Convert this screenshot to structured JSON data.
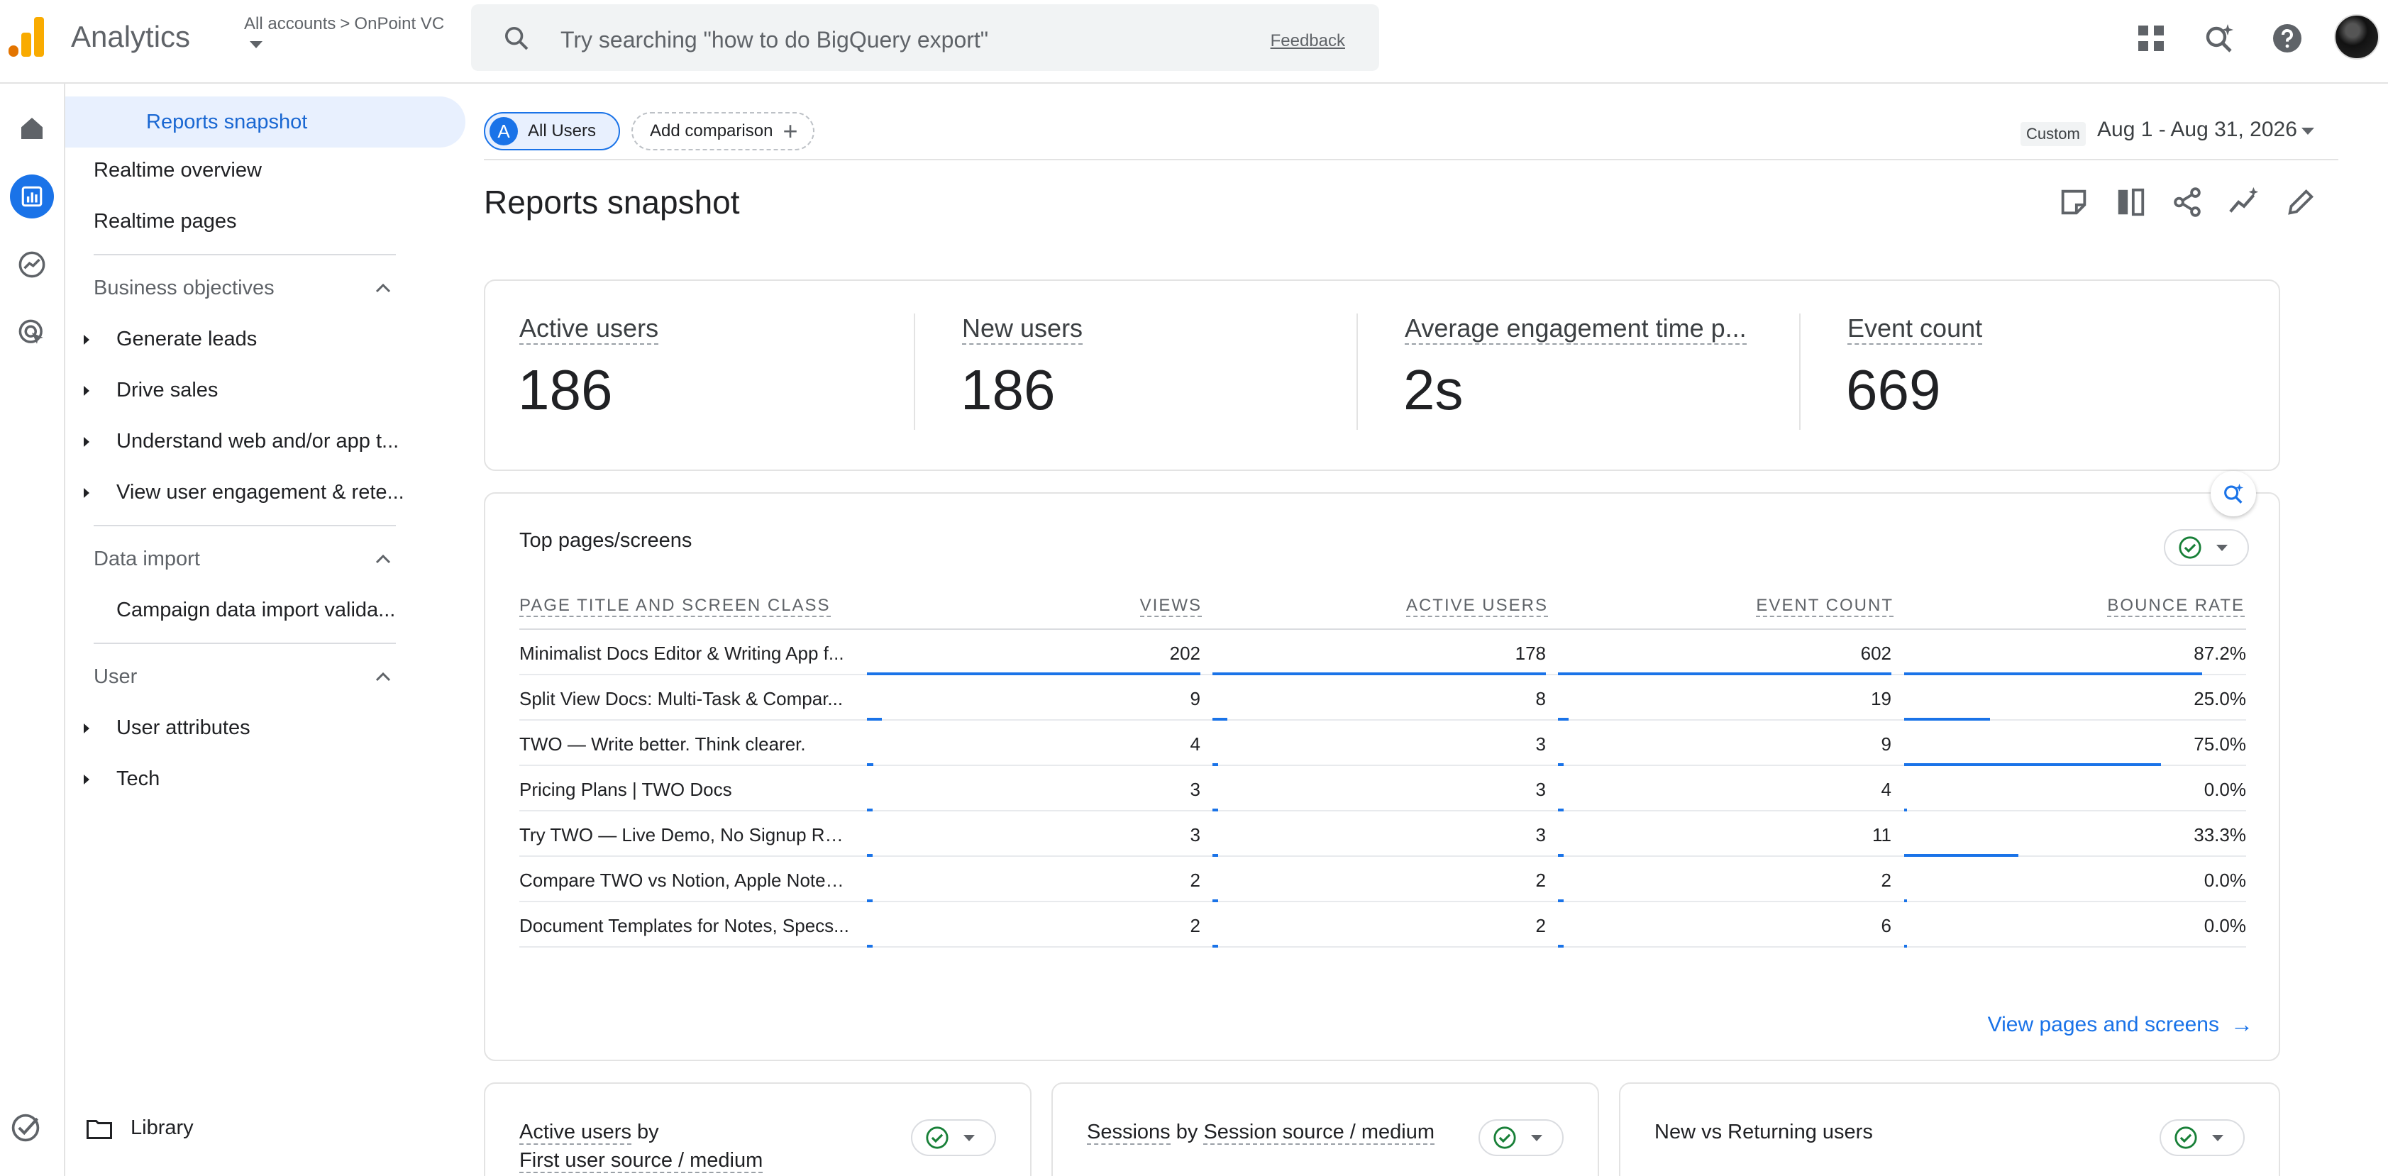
{
  "header": {
    "app_title": "Analytics",
    "account_path": [
      "All accounts",
      "OnPoint VC"
    ],
    "search_placeholder": "Try searching \"how to do BigQuery export\"",
    "feedback_label": "Feedback"
  },
  "sidebar": {
    "top_items": [
      "Reports snapshot",
      "Realtime overview",
      "Realtime pages"
    ],
    "sections": [
      {
        "title": "Business objectives",
        "items": [
          "Generate leads",
          "Drive sales",
          "Understand web and/or app t...",
          "View user engagement & rete..."
        ]
      },
      {
        "title": "Data import",
        "items": [
          "Campaign data import valida..."
        ]
      },
      {
        "title": "User",
        "items": [
          "User attributes",
          "Tech"
        ]
      }
    ],
    "library_label": "Library"
  },
  "toolbar": {
    "segment_badge": "A",
    "segment_label": "All Users",
    "add_comparison_label": "Add comparison",
    "date_mode": "Custom",
    "date_range": "Aug 1 - Aug 31, 2026"
  },
  "page_title": "Reports snapshot",
  "kpis": [
    {
      "label": "Active users",
      "value": "186"
    },
    {
      "label": "New users",
      "value": "186"
    },
    {
      "label": "Average engagement time p...",
      "value": "2s"
    },
    {
      "label": "Event count",
      "value": "669"
    }
  ],
  "top_pages": {
    "title": "Top pages/screens",
    "columns": [
      "PAGE TITLE AND SCREEN CLASS",
      "VIEWS",
      "ACTIVE USERS",
      "EVENT COUNT",
      "BOUNCE RATE"
    ],
    "rows": [
      {
        "name": "Minimalist Docs Editor & Writing App f...",
        "views": "202",
        "active": "178",
        "events": "602",
        "bounce": "87.2%",
        "bars": [
          1.0,
          1.0,
          1.0,
          0.872
        ]
      },
      {
        "name": "Split View Docs: Multi-Task & Compar...",
        "views": "9",
        "active": "8",
        "events": "19",
        "bounce": "25.0%",
        "bars": [
          0.045,
          0.045,
          0.032,
          0.25
        ]
      },
      {
        "name": "TWO — Write better. Think clearer.",
        "views": "4",
        "active": "3",
        "events": "9",
        "bounce": "75.0%",
        "bars": [
          0.02,
          0.017,
          0.015,
          0.75
        ]
      },
      {
        "name": "Pricing Plans | TWO Docs",
        "views": "3",
        "active": "3",
        "events": "4",
        "bounce": "0.0%",
        "bars": [
          0.015,
          0.017,
          0.007,
          0.0
        ]
      },
      {
        "name": "Try TWO — Live Demo, No Signup Req...",
        "views": "3",
        "active": "3",
        "events": "11",
        "bounce": "33.3%",
        "bars": [
          0.015,
          0.017,
          0.018,
          0.333
        ]
      },
      {
        "name": "Compare TWO vs Notion, Apple Notes,...",
        "views": "2",
        "active": "2",
        "events": "2",
        "bounce": "0.0%",
        "bars": [
          0.01,
          0.011,
          0.003,
          0.0
        ]
      },
      {
        "name": "Document Templates for Notes, Specs...",
        "views": "2",
        "active": "2",
        "events": "6",
        "bounce": "0.0%",
        "bars": [
          0.01,
          0.011,
          0.01,
          0.0
        ]
      }
    ],
    "view_link": "View pages and screens"
  },
  "bottom_cards": [
    {
      "title_part1": "Active users",
      "title_part2": "by",
      "title_part3": "First user source / medium"
    },
    {
      "title_part1": "Sessions",
      "title_part2": "by",
      "title_part3": "Session source / medium"
    },
    {
      "title_part1": "New vs Returning users"
    }
  ],
  "colors": {
    "accent": "#1a73e8",
    "check_green": "#188038",
    "logo_orange": "#f9ab00",
    "logo_dark_orange": "#e37400"
  }
}
